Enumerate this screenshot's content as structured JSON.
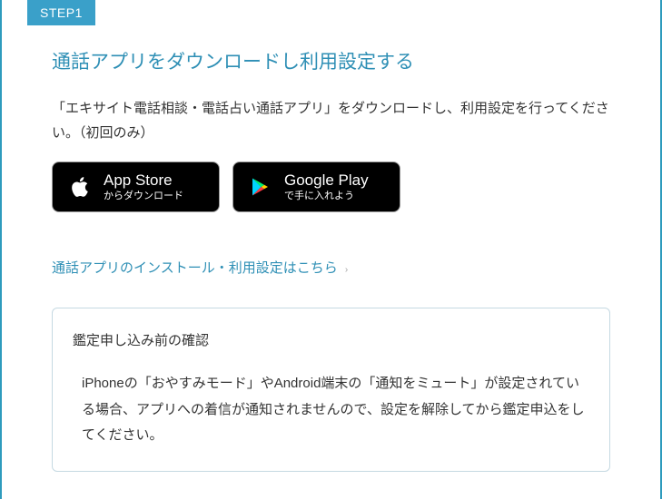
{
  "step": {
    "badge": "STEP1",
    "title": "通話アプリをダウンロードし利用設定する",
    "description": "「エキサイト電話相談・電話占い通話アプリ」をダウンロードし、利用設定を行ってください。（初回のみ）"
  },
  "stores": {
    "apple": {
      "line1": "App Store",
      "line2": "からダウンロード"
    },
    "google": {
      "line1": "Google Play",
      "line2": "で手に入れよう"
    }
  },
  "installLink": {
    "text": "通話アプリのインストール・利用設定はこちら",
    "chevron": "›"
  },
  "infoBox": {
    "title": "鑑定申し込み前の確認",
    "text": "iPhoneの「おやすみモード」やAndroid端末の「通知をミュート」が設定されている場合、アプリへの着信が通知されませんので、設定を解除してから鑑定申込をしてください。"
  }
}
